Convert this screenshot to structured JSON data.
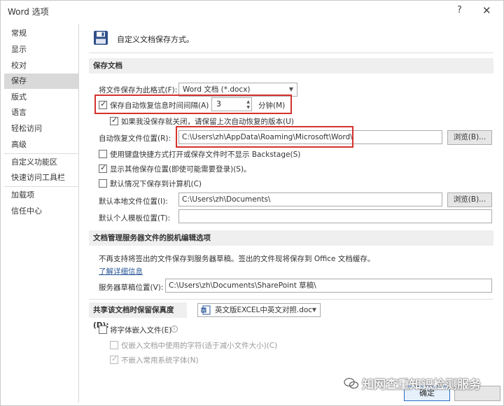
{
  "window": {
    "title": "Word 选项",
    "help": "?",
    "close": "✕"
  },
  "sidebar": {
    "items": [
      "常规",
      "显示",
      "校对",
      "保存",
      "版式",
      "语言",
      "轻松访问",
      "高级",
      "自定义功能区",
      "快速访问工具栏",
      "加载项",
      "信任中心"
    ],
    "active": "保存"
  },
  "header": {
    "text": "自定义文档保存方式。"
  },
  "save_section": {
    "title": "保存文档",
    "format_label": "将文件保存为此格式(F):",
    "format_value": "Word 文档 (*.docx)",
    "autorecover_label": "保存自动恢复信息时间间隔(A)",
    "autorecover_value": "3",
    "minutes_label": "分钟(M)",
    "keep_last_label": "如果我没保存就关闭，请保留上次自动恢复的版本(U)",
    "autorecover_location_label": "自动恢复文件位置(R):",
    "autorecover_location_value": "C:\\Users\\zh\\AppData\\Roaming\\Microsoft\\Word\\",
    "browse_label": "浏览(B)...",
    "backstage_label": "使用键盘快捷方式打开或保存文件时不显示 Backstage(S)",
    "show_additional_label": "显示其他保存位置(即使可能需要登录)(S)。",
    "save_to_computer_label": "默认情况下保存到计算机(C)",
    "local_location_label": "默认本地文件位置(I):",
    "local_location_value": "C:\\Users\\zh\\Documents\\",
    "browse2_label": "浏览(B)...",
    "template_location_label": "默认个人模板位置(T):",
    "template_location_value": ""
  },
  "offline_section": {
    "title": "文档管理服务器文件的脱机编辑选项",
    "desc": "不再支持将签出的文件保存到服务器草稿。签出的文件现将保存到 Office 文档缓存。",
    "learn_more": "了解详细信息",
    "drafts_label": "服务器草稿位置(V):",
    "drafts_value": "C:\\Users\\zh\\Documents\\SharePoint 草稿\\"
  },
  "fidelity_section": {
    "title": "共享该文档时保留保真度(D):",
    "doc_value": "英文版EXCEL中英文对照.doc",
    "embed_fonts_label": "将字体嵌入文件(E)",
    "embed_used_label": "仅嵌入文档中使用的字符(适于减小文件大小)(C)",
    "no_common_label": "不嵌入常用系统字体(N)"
  },
  "footer": {
    "ok": "确定"
  },
  "watermark": {
    "text": "知网查重知识检测服务"
  }
}
